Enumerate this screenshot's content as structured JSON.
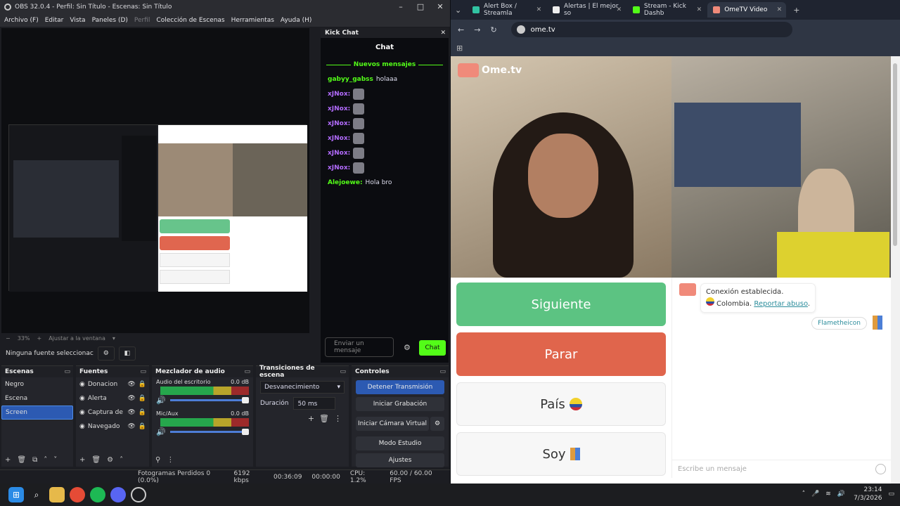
{
  "obs": {
    "title": "OBS 32.0.4 - Perfil: Sin Título - Escenas: Sin Título",
    "menu": [
      "Archivo (F)",
      "Editar",
      "Vista",
      "Paneles (D)",
      "Perfil",
      "Colección de Escenas",
      "Herramientas",
      "Ayuda (H)"
    ],
    "zoom": "33%",
    "fit": "Ajustar a la ventana",
    "no_source": "Ninguna fuente seleccionac",
    "chat": {
      "dock_title": "Kick Chat",
      "title": "Chat",
      "new_messages": "Nuevos mensajes",
      "messages": [
        {
          "user": "gabyy_gabss",
          "text": "holaaa",
          "color": "#53fc18"
        },
        {
          "user": "xJNox:",
          "text": "",
          "color": "#b46cff"
        },
        {
          "user": "xJNox:",
          "text": "",
          "color": "#b46cff"
        },
        {
          "user": "xJNox:",
          "text": "",
          "color": "#b46cff"
        },
        {
          "user": "xJNox:",
          "text": "",
          "color": "#b46cff"
        },
        {
          "user": "xJNox:",
          "text": "",
          "color": "#b46cff"
        },
        {
          "user": "xJNox:",
          "text": "",
          "color": "#b46cff"
        },
        {
          "user": "Alejoewe:",
          "text": "Hola bro",
          "color": "#53fc18"
        }
      ],
      "input_placeholder": "Enviar un mensaje",
      "send": "Chat"
    },
    "scenes": {
      "title": "Escenas",
      "items": [
        "Negro",
        "Escena",
        "Screen"
      ]
    },
    "sources": {
      "title": "Fuentes",
      "items": [
        "Donacion",
        "Alerta",
        "Captura de",
        "Navegado"
      ]
    },
    "mixer": {
      "title": "Mezclador de audio",
      "tracks": [
        {
          "name": "Audio del escritorio",
          "db": "0.0 dB"
        },
        {
          "name": "Mic/Aux",
          "db": "0.0 dB"
        }
      ]
    },
    "transitions": {
      "title": "Transiciones de escena",
      "type": "Desvanecimiento",
      "duration_label": "Duración",
      "duration": "50 ms"
    },
    "controls": {
      "title": "Controles",
      "buttons": [
        "Detener Transmisión",
        "Iniciar Grabación",
        "Iniciar Cámara Virtual",
        "Modo Estudio",
        "Ajustes"
      ]
    },
    "status": {
      "frames": "Fotogramas Perdidos 0 (0.0%)",
      "kbps": "6192 kbps",
      "live": "00:36:09",
      "rec": "00:00:00",
      "cpu": "CPU: 1.2%",
      "fps": "60.00 / 60.00 FPS"
    }
  },
  "browser": {
    "tabs": [
      {
        "label": "Alert Box / Streamla",
        "color": "#31c3a2"
      },
      {
        "label": "Alertas | El mejor so",
        "color": "#eee"
      },
      {
        "label": "Stream - Kick Dashb",
        "color": "#53fc18"
      },
      {
        "label": "OmeTV Video",
        "color": "#f08a7a"
      }
    ],
    "url": "ome.tv",
    "logo": "Ome.tv",
    "buttons": {
      "next": "Siguiente",
      "stop": "Parar",
      "country": "País",
      "soy": "Soy"
    },
    "chat": {
      "line1": "Conexión establecida.",
      "line2": "Colombia.",
      "report": "Reportar abuso",
      "my_msg": "Flametheicon",
      "placeholder": "Escribe un mensaje"
    }
  },
  "taskbar": {
    "time": "23:14",
    "date": "7/3/2026"
  }
}
